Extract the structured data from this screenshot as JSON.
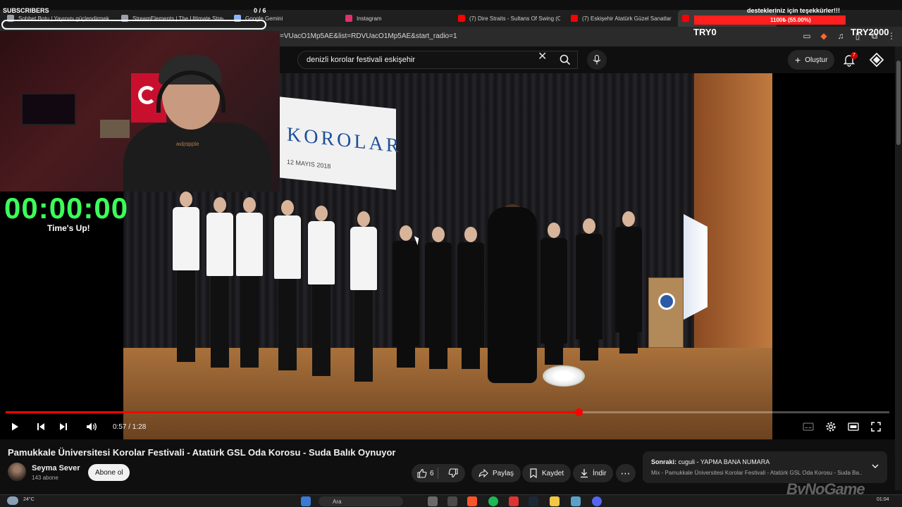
{
  "browser": {
    "tabs": [
      {
        "label": "Sohbet Botu | Yayınını güçlendirmek",
        "color": "#9aa0a6"
      },
      {
        "label": "StreamElements | The Ultimate Strea",
        "color": "#9aa0a6"
      },
      {
        "label": "Google Gemini",
        "color": "#8ab4f8"
      },
      {
        "label": "Instagram",
        "color": "#e1306c"
      },
      {
        "label": "(7) Dire Straits - Sultans Of Swing (C",
        "color": "#ff0000"
      },
      {
        "label": "(7) Eskişehir Atatürk Güzel Sanatlar",
        "color": "#ff0000"
      },
      {
        "label": "",
        "color": "#ff0000"
      }
    ],
    "url": "=VUacO1Mp5AE&list=RDVUacO1Mp5AE&start_radio=1"
  },
  "youtube": {
    "search_value": "denizli korolar festivali eskişehir",
    "create_label": "Oluştur",
    "notification_count": "7"
  },
  "video": {
    "banner_text": "KOROLAR",
    "banner_date": "12 MAYIS 2018",
    "current_time": "0:57",
    "duration": "1:28",
    "time_display": "0:57 / 1:28",
    "progress_fraction": 0.648
  },
  "webcam": {
    "hoodie_text": "ɘlqqɒɿbʍ"
  },
  "overlays": {
    "subscribers_label": "SUBSCRIBERS",
    "subscribers_count": "0 / 6",
    "donation_title": "destekleriniz için teşekkürler!!!",
    "donation_value": "1100₺ (55.00%)",
    "donation_fraction": 0.55,
    "goal_left": "TRY0",
    "goal_right": "TRY2000",
    "timer": "00:00:00",
    "timer_caption": "Time's Up!"
  },
  "info": {
    "title": "Pamukkale Üniversitesi Korolar Festivali - Atatürk GSL Oda Korosu - Suda Balık Oynuyor",
    "channel": "Seyma Sever",
    "subscribers": "143 abone",
    "subscribe_label": "Abone ol",
    "likes": "6",
    "share_label": "Paylaş",
    "save_label": "Kaydet",
    "download_label": "İndir"
  },
  "next": {
    "prefix": "Sonraki:",
    "title": "cuguli - YAPMA BANA NUMARA",
    "playlist": "Mix - Pamukkale Üniversitesi Korolar Festivali - Atatürk GSL Oda Korosu - Suda Ba..."
  },
  "taskbar": {
    "temperature": "24°C",
    "search_label": "Ara",
    "clock": "01:04"
  },
  "watermark": "ByNoGame",
  "colors": {
    "accent": "#ff0000",
    "timer": "#3cff5a",
    "bg": "#0f0f0f"
  }
}
